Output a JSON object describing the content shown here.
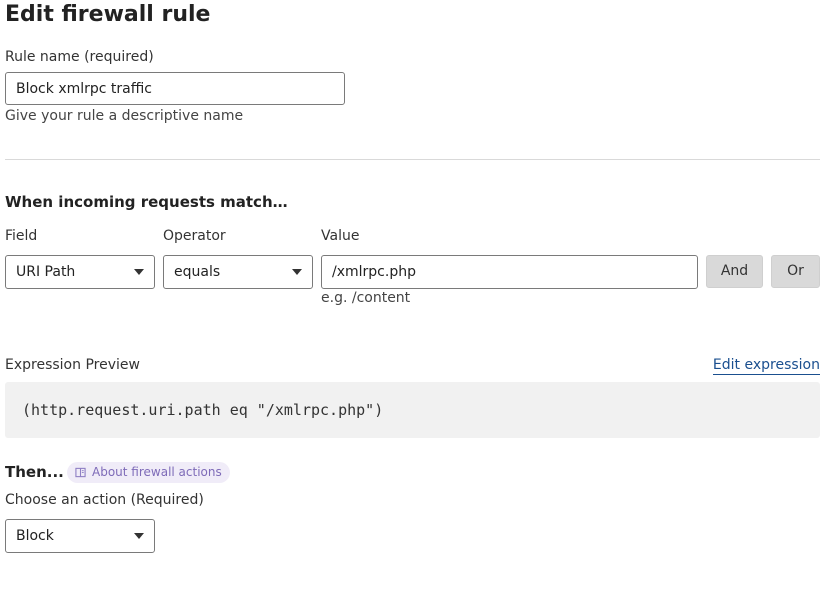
{
  "page": {
    "title": "Edit firewall rule"
  },
  "rule_name": {
    "label": "Rule name (required)",
    "value": "Block xmlrpc traffic",
    "help": "Give your rule a descriptive name"
  },
  "match": {
    "heading": "When incoming requests match…",
    "field_label": "Field",
    "field_value": "URI Path",
    "operator_label": "Operator",
    "operator_value": "equals",
    "value_label": "Value",
    "value_value": "/xmlrpc.php",
    "value_help": "e.g. /content",
    "and_label": "And",
    "or_label": "Or"
  },
  "expression": {
    "label": "Expression Preview",
    "edit_link": "Edit expression",
    "text": "(http.request.uri.path eq \"/xmlrpc.php\")"
  },
  "then": {
    "heading": "Then...",
    "about_link": "About firewall actions",
    "action_label": "Choose an action (Required)",
    "action_value": "Block"
  }
}
